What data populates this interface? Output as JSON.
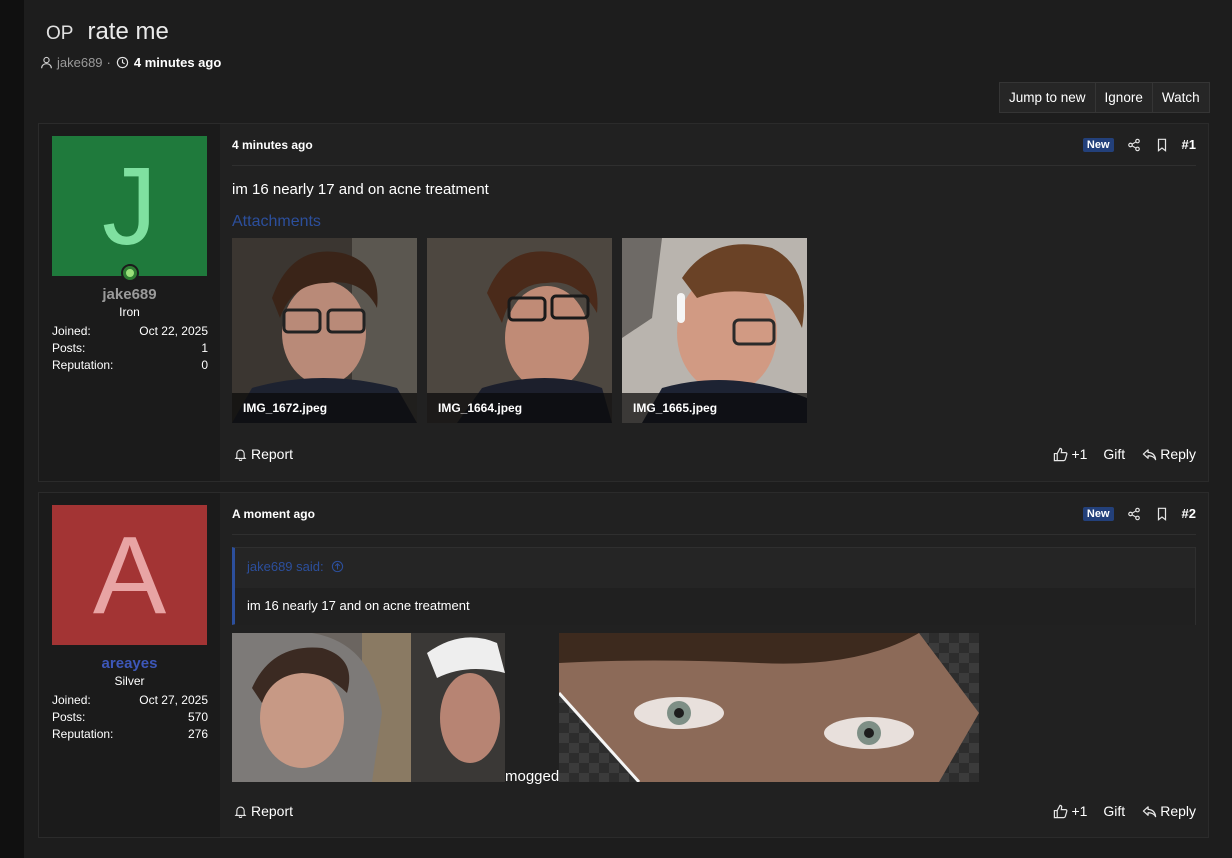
{
  "thread": {
    "op_tag": "OP",
    "title": "rate me",
    "author": "jake689",
    "separator": "·",
    "time": "4 minutes ago"
  },
  "actions": [
    "Jump to new",
    "Ignore",
    "Watch"
  ],
  "posts": [
    {
      "user": {
        "initial": "J",
        "avatar_bg": "#1f7a3c",
        "avatar_fg": "#7fe0a0",
        "name": "jake689",
        "name_color": "#9a9a9a",
        "rank": "Iron",
        "online": true,
        "joined_label": "Joined:",
        "joined": "Oct 22, 2025",
        "posts_label": "Posts:",
        "posts": "1",
        "rep_label": "Reputation:",
        "reputation": "0"
      },
      "date": "4 minutes ago",
      "badge": "New",
      "number": "#1",
      "message": "im 16 nearly 17 and on acne treatment",
      "attachments_label": "Attachments",
      "attachments": [
        "IMG_1672.jpeg",
        "IMG_1664.jpeg",
        "IMG_1665.jpeg"
      ],
      "footer": {
        "report": "Report",
        "like": "+1",
        "gift": "Gift",
        "reply": "Reply"
      }
    },
    {
      "user": {
        "initial": "A",
        "avatar_bg": "#a33434",
        "avatar_fg": "#e8a4a4",
        "name": "areayes",
        "name_color": "#3d57b8",
        "rank": "Silver",
        "online": false,
        "joined_label": "Joined:",
        "joined": "Oct 27, 2025",
        "posts_label": "Posts:",
        "posts": "570",
        "rep_label": "Reputation:",
        "reputation": "276"
      },
      "date": "A moment ago",
      "badge": "New",
      "number": "#2",
      "quote_author": "jake689 said:",
      "quote_text": "im 16 nearly 17 and on acne treatment",
      "message": "mogged",
      "footer": {
        "report": "Report",
        "like": "+1",
        "gift": "Gift",
        "reply": "Reply"
      }
    }
  ],
  "colors": {
    "accent": "#2c4f9c",
    "new_badge": "#23407a",
    "background": "#1d1d1d"
  }
}
